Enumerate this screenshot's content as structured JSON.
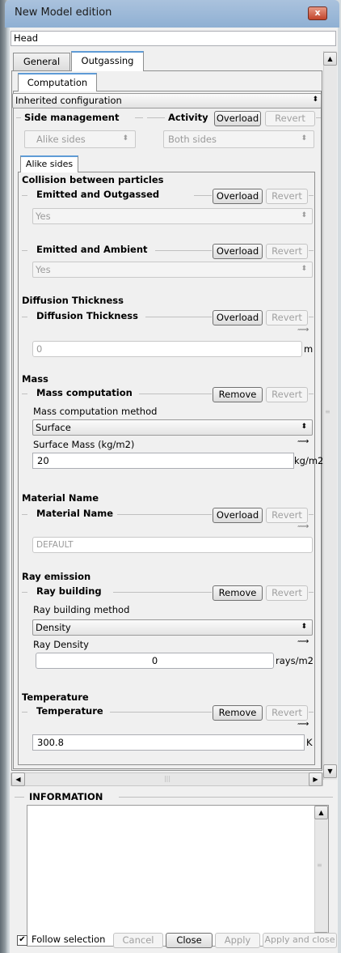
{
  "window": {
    "title": "New Model edition",
    "close_glyph": "x"
  },
  "name_value": "Head",
  "tabs": [
    {
      "label": "General"
    },
    {
      "label": "Outgassing"
    }
  ],
  "subtab": "Computation",
  "configuration": "Inherited configuration",
  "side_management": {
    "title": "Side management",
    "value": "Alike sides"
  },
  "activity": {
    "title": "Activity",
    "overload": "Overload",
    "revert": "Revert",
    "value": "Both sides"
  },
  "inner_tab": "Alike sides",
  "collision": {
    "title": "Collision between particles",
    "emitted_outgassed": {
      "title": "Emitted and Outgassed",
      "btn": "Overload",
      "revert": "Revert",
      "value": "Yes"
    },
    "emitted_ambient": {
      "title": "Emitted and Ambient",
      "btn": "Overload",
      "revert": "Revert",
      "value": "Yes"
    }
  },
  "diffusion": {
    "title": "Diffusion Thickness",
    "group": "Diffusion Thickness",
    "btn": "Overload",
    "revert": "Revert",
    "value": "0",
    "unit": "m"
  },
  "mass": {
    "title": "Mass",
    "group": "Mass computation",
    "btn": "Remove",
    "revert": "Revert",
    "method_label": "Mass computation method",
    "method": "Surface",
    "surface_label": "Surface Mass (kg/m2)",
    "value": "20",
    "unit": "kg/m2"
  },
  "material": {
    "title": "Material Name",
    "group": "Material Name",
    "btn": "Overload",
    "revert": "Revert",
    "value": "DEFAULT"
  },
  "ray": {
    "title": "Ray emission",
    "group": "Ray building",
    "btn": "Remove",
    "revert": "Revert",
    "method_label": "Ray building method",
    "method": "Density",
    "density_label": "Ray Density",
    "value": "0",
    "unit": "rays/m2"
  },
  "temperature": {
    "title": "Temperature",
    "group": "Temperature",
    "btn": "Remove",
    "revert": "Revert",
    "value": "300.8",
    "unit": "K"
  },
  "information": {
    "title": "INFORMATION"
  },
  "footer": {
    "follow": "Follow selection",
    "checked": true,
    "cancel": "Cancel",
    "close": "Close",
    "apply": "Apply",
    "apply_close": "Apply and close"
  },
  "icons": {
    "combo_arrow": "updown-arrow-icon",
    "function_icon": "function-curve-icon"
  }
}
